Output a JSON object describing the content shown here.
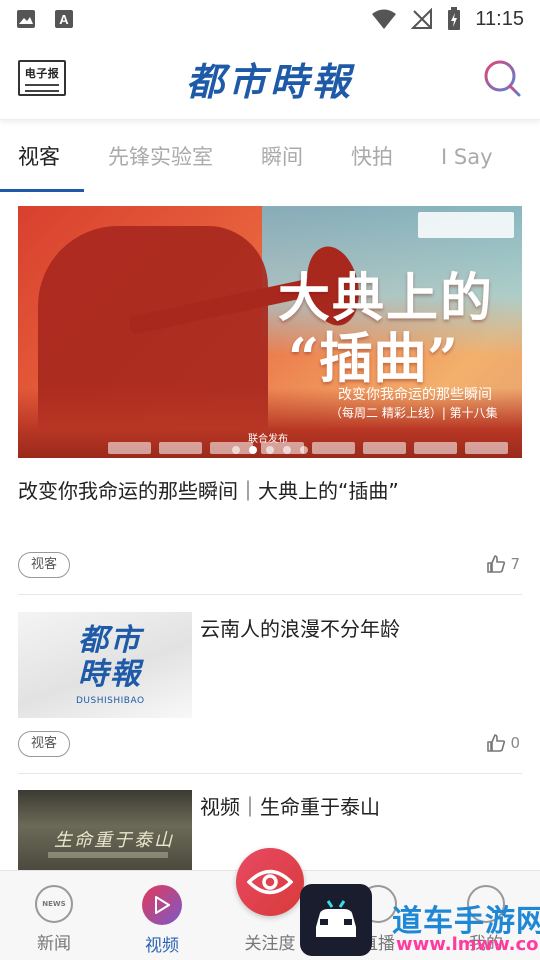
{
  "status": {
    "time": "11:15",
    "icons": [
      "image-icon",
      "a-notification-icon",
      "wifi-icon",
      "no-signal-icon",
      "battery-charging-icon"
    ]
  },
  "header": {
    "epaper_label": "电子报",
    "brand_title": "都市時報",
    "search_icon": "search-icon",
    "brand_color": "#1e5aa8"
  },
  "tabs": [
    {
      "label": "视客",
      "active": true
    },
    {
      "label": "先锋实验室",
      "active": false
    },
    {
      "label": "瞬间",
      "active": false
    },
    {
      "label": "快拍",
      "active": false
    },
    {
      "label": "I Say",
      "active": false
    }
  ],
  "hero": {
    "title_line1": "大典上的",
    "title_line2": "“插曲”",
    "subtitle1": "改变你我命运的那些瞬间",
    "subtitle2": "（每周二 精彩上线）| 第十八集",
    "publisher_line": "联合发布",
    "carousel_count": 5,
    "carousel_active": 1
  },
  "articles": [
    {
      "title": "改变你我命运的那些瞬间｜大典上的“插曲”",
      "tag": "视客",
      "likes": "7"
    },
    {
      "title": "云南人的浪漫不分年龄",
      "tag": "视客",
      "likes": "0",
      "thumb_title": "都市時報",
      "thumb_en": "DUSHISHIBAO"
    },
    {
      "title": "视频｜生命重于泰山",
      "thumb_title": "生命重于泰山"
    }
  ],
  "bottom_nav": {
    "items": [
      {
        "label": "新闻",
        "icon": "NEWS",
        "active": false
      },
      {
        "label": "视频",
        "active": true
      },
      {
        "label": "关注度",
        "active": false
      },
      {
        "label": "直播",
        "active": false
      },
      {
        "label": "我的",
        "active": false
      }
    ],
    "active_color": "#2b64b4"
  },
  "watermark": {
    "text": "道车手游网",
    "url": "www.lmww.com"
  }
}
